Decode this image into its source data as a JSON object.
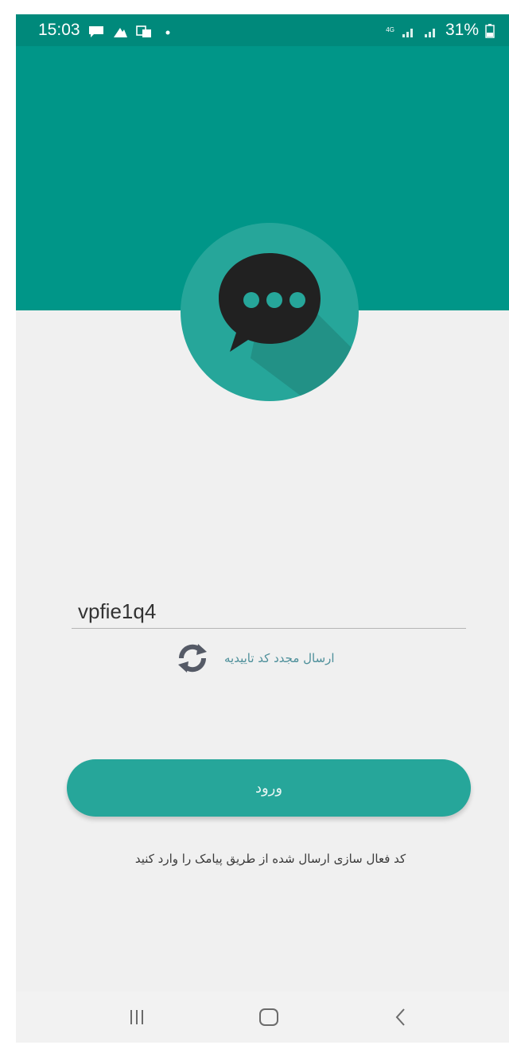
{
  "status_bar": {
    "time": "15:03",
    "battery": "31%",
    "network": "4G"
  },
  "form": {
    "code_value": "vpfie1q4",
    "resend_label": "ارسال مجدد کد تاییدیه",
    "login_label": "ورود",
    "hint": "کد فعال سازی ارسال شده از طریق پیامک را وارد کنید"
  },
  "icons": {
    "logo": "chat-bubble-icon",
    "resend": "refresh-icon",
    "nav_recent": "recent-apps-icon",
    "nav_home": "home-icon",
    "nav_back": "back-icon"
  },
  "colors": {
    "header": "#009688",
    "status_bar": "#00897b",
    "accent": "#26a69a",
    "background": "#f0f0f0",
    "link": "#4d8f9a"
  }
}
